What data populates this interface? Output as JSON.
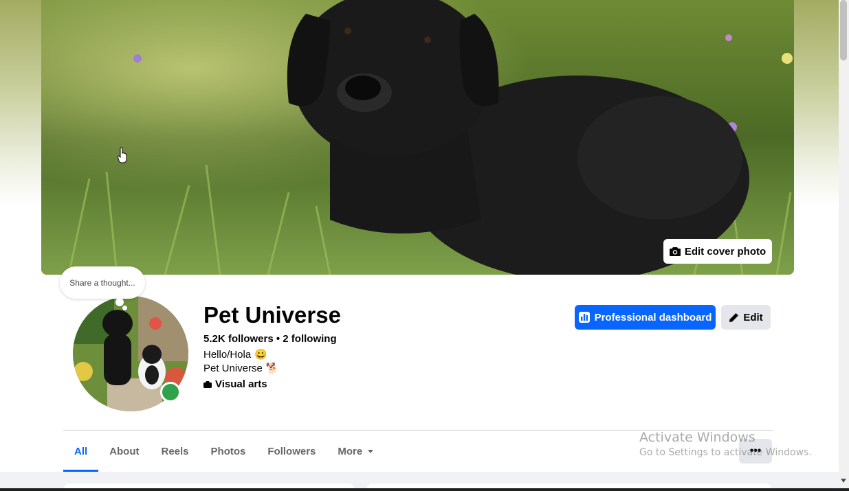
{
  "cover": {
    "edit_label": "Edit cover photo"
  },
  "thought": {
    "placeholder": "Share a thought..."
  },
  "profile": {
    "name": "Pet Universe",
    "stats": "5.2K followers • 2 following",
    "bio": [
      {
        "text": "Hello/Hola",
        "emoji": "😀"
      },
      {
        "text": "Pet Universe",
        "emoji": "🐕"
      }
    ],
    "category": "Visual arts"
  },
  "actions": {
    "dashboard_label": "Professional dashboard",
    "edit_label": "Edit"
  },
  "tabs": [
    {
      "label": "All",
      "active": true
    },
    {
      "label": "About"
    },
    {
      "label": "Reels"
    },
    {
      "label": "Photos"
    },
    {
      "label": "Followers"
    },
    {
      "label": "More"
    }
  ],
  "overflow_menu": {
    "label": "•••"
  },
  "watermark": {
    "line1": "Activate Windows",
    "line2": "Go to Settings to activate Windows."
  },
  "colors": {
    "accent": "#0866ff",
    "online": "#31a24c",
    "secondary_button": "#e4e6eb"
  },
  "icons": [
    "camera-icon",
    "dashboard-icon",
    "pencil-icon",
    "category-icon",
    "caret-down-icon",
    "more-dots-icon"
  ]
}
